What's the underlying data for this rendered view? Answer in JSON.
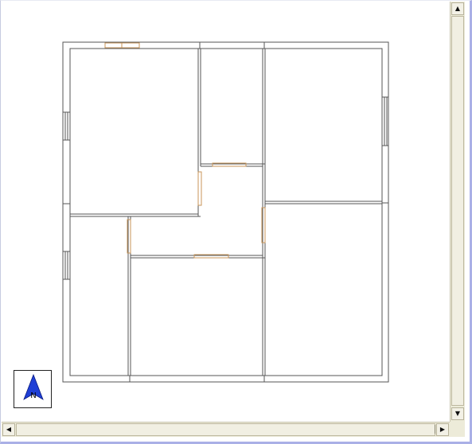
{
  "scrollbars": {
    "up_glyph": "▲",
    "down_glyph": "▼",
    "left_glyph": "◀",
    "right_glyph": "▶"
  },
  "north_arrow": {
    "label": "N",
    "color": "#1f3fd6"
  },
  "plan": {
    "wall_color": "#555555",
    "door_color": "#c8965a"
  }
}
